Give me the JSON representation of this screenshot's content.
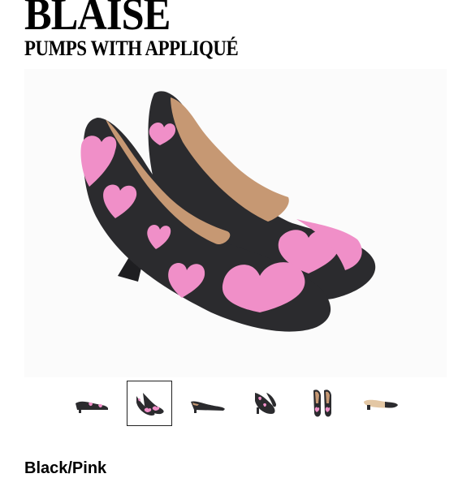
{
  "product": {
    "name": "BLAISE",
    "subtitle": "PUMPS WITH APPLIQUÉ",
    "color_name": "Black/Pink"
  },
  "gallery": {
    "selected_index": 1,
    "thumbnails": [
      {
        "icon": "shoe-side-view-icon"
      },
      {
        "icon": "shoe-pair-angle-icon"
      },
      {
        "icon": "shoe-inner-side-icon"
      },
      {
        "icon": "shoe-front-angle-icon"
      },
      {
        "icon": "shoe-pair-top-icon"
      },
      {
        "icon": "shoe-sole-icon"
      }
    ]
  },
  "colors": {
    "leather": "#2b2b2e",
    "heart": "#f08fc8",
    "lining": "#c69873",
    "background": "#fbfbfb"
  }
}
